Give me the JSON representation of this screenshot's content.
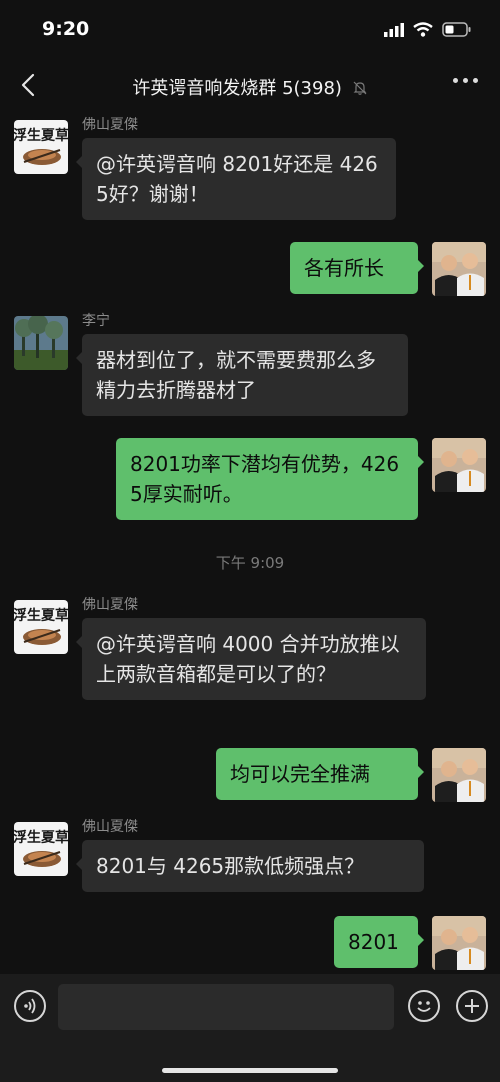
{
  "status_bar": {
    "time": "9:20"
  },
  "header": {
    "title": "许英谔音响发烧群 5(398)"
  },
  "messages": [
    {
      "side": "left",
      "sender": "佛山夏傑",
      "text": "@许英谔音响 8201好还是 4265好？谢谢！",
      "avatar": "calligraphy-avatar"
    },
    {
      "side": "right",
      "text": "各有所长",
      "avatar": "two-men-avatar"
    },
    {
      "side": "left",
      "sender": "李宁",
      "text": "器材到位了，就不需要费那么多精力去折腾器材了",
      "avatar": "forest-avatar"
    },
    {
      "side": "right",
      "text": "8201功率下潜均有优势，4265厚实耐听。",
      "avatar": "two-men-avatar"
    },
    {
      "type": "timestamp",
      "text": "下午 9:09"
    },
    {
      "side": "left",
      "sender": "佛山夏傑",
      "text": "@许英谔音响 4000 合并功放推以上两款音箱都是可以了的？",
      "avatar": "calligraphy-avatar"
    },
    {
      "side": "right",
      "text": "均可以完全推满",
      "avatar": "two-men-avatar"
    },
    {
      "side": "left",
      "sender": "佛山夏傑",
      "text": "8201与 4265那款低频强点？",
      "avatar": "calligraphy-avatar"
    },
    {
      "side": "right",
      "text": "8201",
      "avatar": "two-men-avatar"
    }
  ],
  "colors": {
    "background": "#111111",
    "bubble_left": "#2c2c2c",
    "bubble_right": "#5fbf6c"
  }
}
